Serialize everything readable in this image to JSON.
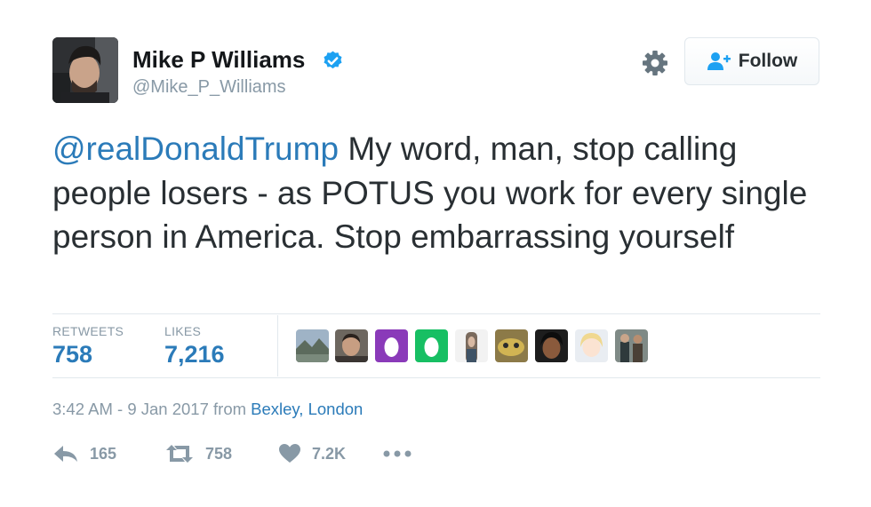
{
  "author": {
    "name": "Mike P Williams",
    "handle": "@Mike_P_Williams",
    "verified": true
  },
  "follow_button": {
    "label": "Follow",
    "icon": "person-plus-icon"
  },
  "settings_icon": "gear-icon",
  "tweet": {
    "mention": "@realDonaldTrump",
    "text": " My word, man, stop calling people losers - as POTUS you work for every single person in America. Stop embarrassing yourself"
  },
  "stats": {
    "retweets_label": "RETWEETS",
    "retweets_value": "758",
    "likes_label": "LIKES",
    "likes_value": "7,216"
  },
  "likers": [
    {
      "name": "liker-landscape"
    },
    {
      "name": "liker-man"
    },
    {
      "name": "liker-egg-purple",
      "color": "#8a3ab9"
    },
    {
      "name": "liker-egg-green",
      "color": "#17bf63"
    },
    {
      "name": "liker-woman"
    },
    {
      "name": "liker-animal"
    },
    {
      "name": "liker-person-dark"
    },
    {
      "name": "liker-anime"
    },
    {
      "name": "liker-people"
    }
  ],
  "meta": {
    "time": "3:42 AM - 9 Jan 2017",
    "from_label": "from",
    "location": "Bexley, London"
  },
  "actions": {
    "reply_count": "165",
    "retweet_count": "758",
    "like_count": "7.2K"
  },
  "colors": {
    "link": "#2b7bb9",
    "muted": "#8899a6",
    "text": "#292f33",
    "border": "#e1e8ed",
    "verified": "#1da1f2"
  }
}
